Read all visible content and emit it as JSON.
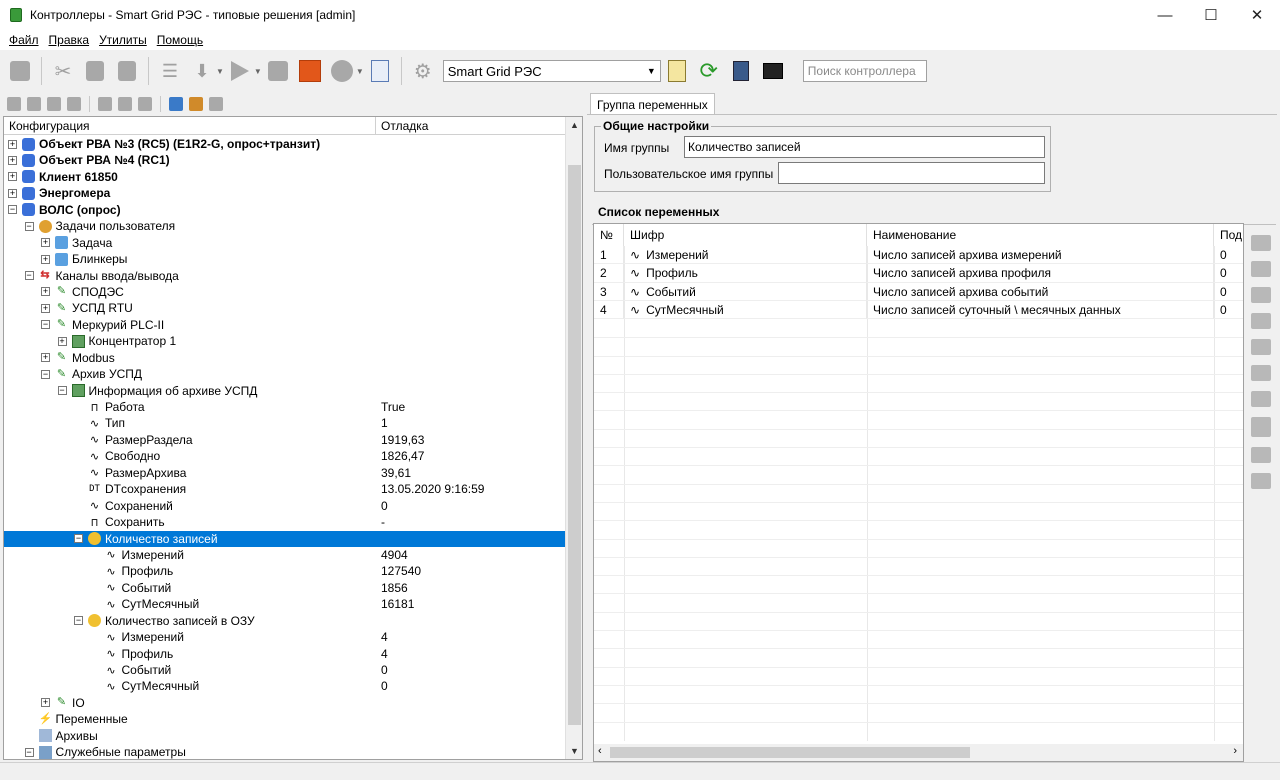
{
  "window": {
    "title": "Контроллеры - Smart Grid РЭС - типовые решения [admin]",
    "min": "—",
    "max": "☐",
    "close": "✕"
  },
  "menu": [
    "Файл",
    "Правка",
    "Утилиты",
    "Помощь"
  ],
  "toolbar": {
    "combo_value": "Smart Grid РЭС",
    "search_placeholder": "Поиск контроллера"
  },
  "tree": {
    "col_config": "Конфигурация",
    "col_debug": "Отладка",
    "rows": [
      {
        "level": 0,
        "exp": "+",
        "icon": "object-icon",
        "label": "Объект РВА №3 (RC5) (E1R2-G, опрос+транзит)",
        "value": "",
        "bold": true
      },
      {
        "level": 0,
        "exp": "+",
        "icon": "object-icon",
        "label": "Объект РВА №4 (RC1)",
        "value": "",
        "bold": true
      },
      {
        "level": 0,
        "exp": "+",
        "icon": "object-icon",
        "label": "Клиент 61850",
        "value": "",
        "bold": true
      },
      {
        "level": 0,
        "exp": "+",
        "icon": "object-icon",
        "label": "Энергомера",
        "value": "",
        "bold": true
      },
      {
        "level": 0,
        "exp": "−",
        "icon": "object-icon",
        "label": "ВОЛС (опрос)",
        "value": "",
        "bold": true
      },
      {
        "level": 1,
        "exp": "−",
        "icon": "tasks-icon",
        "label": "Задачи пользователя",
        "value": ""
      },
      {
        "level": 2,
        "exp": "+",
        "icon": "cube-icon",
        "label": "Задача",
        "value": ""
      },
      {
        "level": 2,
        "exp": "+",
        "icon": "cube-icon",
        "label": "Блинкеры",
        "value": ""
      },
      {
        "level": 1,
        "exp": "−",
        "icon": "channels-icon",
        "label": "Каналы ввода/вывода",
        "value": ""
      },
      {
        "level": 2,
        "exp": "+",
        "icon": "plug-icon",
        "label": "СПОДЭС",
        "value": ""
      },
      {
        "level": 2,
        "exp": "+",
        "icon": "plug-icon",
        "label": "УСПД RTU",
        "value": ""
      },
      {
        "level": 2,
        "exp": "−",
        "icon": "plug-icon",
        "label": "Меркурий PLC-II",
        "value": ""
      },
      {
        "level": 3,
        "exp": "+",
        "icon": "device-icon",
        "label": "Концентратор 1",
        "value": ""
      },
      {
        "level": 2,
        "exp": "+",
        "icon": "plug-icon",
        "label": "Modbus",
        "value": ""
      },
      {
        "level": 2,
        "exp": "−",
        "icon": "plug-icon",
        "label": "Архив УСПД",
        "value": ""
      },
      {
        "level": 3,
        "exp": "−",
        "icon": "device-icon",
        "label": "Информация об архиве УСПД",
        "value": ""
      },
      {
        "level": 4,
        "exp": "",
        "icon": "bool-icon",
        "label": "Работа",
        "value": "True"
      },
      {
        "level": 4,
        "exp": "",
        "icon": "analog-icon",
        "label": "Тип",
        "value": "1"
      },
      {
        "level": 4,
        "exp": "",
        "icon": "analog-icon",
        "label": "РазмерРаздела",
        "value": "1919,63"
      },
      {
        "level": 4,
        "exp": "",
        "icon": "analog-icon",
        "label": "Свободно",
        "value": "1826,47"
      },
      {
        "level": 4,
        "exp": "",
        "icon": "analog-icon",
        "label": "РазмерАрхива",
        "value": "39,61"
      },
      {
        "level": 4,
        "exp": "",
        "icon": "datetime-icon",
        "label": "DTсохранения",
        "value": "13.05.2020 9:16:59"
      },
      {
        "level": 4,
        "exp": "",
        "icon": "analog-icon",
        "label": "Сохранений",
        "value": "0"
      },
      {
        "level": 4,
        "exp": "",
        "icon": "bool-icon",
        "label": "Сохранить",
        "value": "-"
      },
      {
        "level": 4,
        "exp": "−",
        "icon": "group-icon",
        "label": "Количество записей",
        "value": "",
        "selected": true
      },
      {
        "level": 5,
        "exp": "",
        "icon": "analog-icon",
        "label": "Измерений",
        "value": "4904"
      },
      {
        "level": 5,
        "exp": "",
        "icon": "analog-icon",
        "label": "Профиль",
        "value": "127540"
      },
      {
        "level": 5,
        "exp": "",
        "icon": "analog-icon",
        "label": "Событий",
        "value": "1856"
      },
      {
        "level": 5,
        "exp": "",
        "icon": "analog-icon",
        "label": "СутМесячный",
        "value": "16181"
      },
      {
        "level": 4,
        "exp": "−",
        "icon": "group-icon",
        "label": "Количество записей в ОЗУ",
        "value": ""
      },
      {
        "level": 5,
        "exp": "",
        "icon": "analog-icon",
        "label": "Измерений",
        "value": "4"
      },
      {
        "level": 5,
        "exp": "",
        "icon": "analog-icon",
        "label": "Профиль",
        "value": "4"
      },
      {
        "level": 5,
        "exp": "",
        "icon": "analog-icon",
        "label": "Событий",
        "value": "0"
      },
      {
        "level": 5,
        "exp": "",
        "icon": "analog-icon",
        "label": "СутМесячный",
        "value": "0"
      },
      {
        "level": 2,
        "exp": "+",
        "icon": "plug-icon",
        "label": "IO",
        "value": ""
      },
      {
        "level": 1,
        "exp": "",
        "icon": "variables-icon",
        "label": "Переменные",
        "value": ""
      },
      {
        "level": 1,
        "exp": "",
        "icon": "archives-icon",
        "label": "Архивы",
        "value": ""
      },
      {
        "level": 1,
        "exp": "−",
        "icon": "service-icon",
        "label": "Служебные параметры",
        "value": ""
      }
    ]
  },
  "right": {
    "tab": "Группа переменных",
    "general_title": "Общие настройки",
    "group_name_label": "Имя группы",
    "group_name_value": "Количество записей",
    "user_group_label": "Пользовательское имя группы",
    "user_group_value": "",
    "list_title": "Список переменных",
    "columns": [
      "№",
      "Шифр",
      "Наименование",
      "Под"
    ],
    "rows": [
      {
        "num": "1",
        "code": "Измерений",
        "name": "Число записей архива измерений",
        "sub": "0"
      },
      {
        "num": "2",
        "code": "Профиль",
        "name": "Число записей архива профиля",
        "sub": "0"
      },
      {
        "num": "3",
        "code": "Событий",
        "name": "Число записей архива событий",
        "sub": "0"
      },
      {
        "num": "4",
        "code": "СутМесячный",
        "name": "Число записей суточный \\ месячных данных",
        "sub": "0"
      }
    ]
  }
}
